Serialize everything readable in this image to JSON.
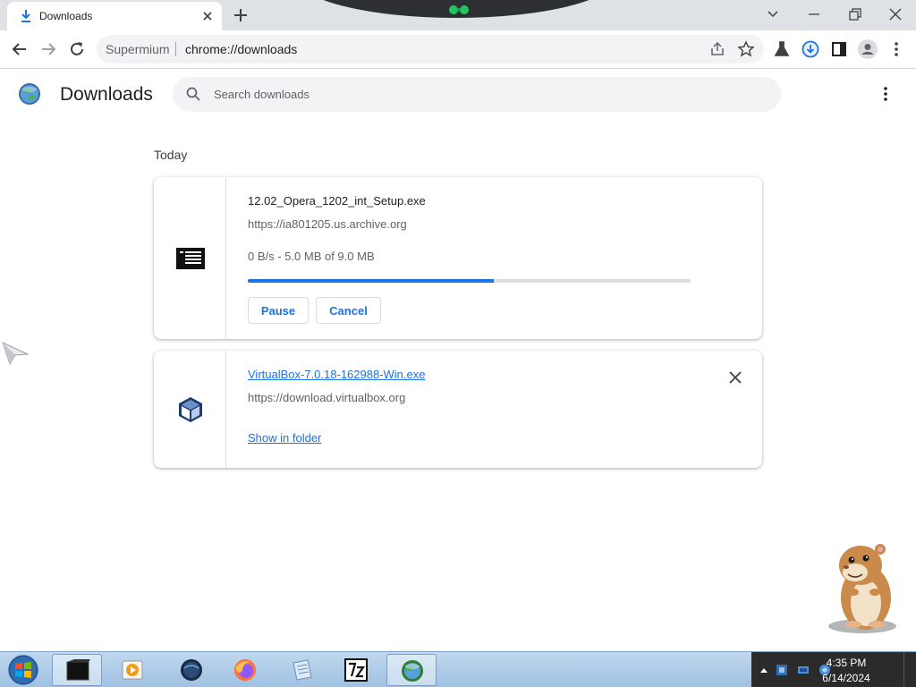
{
  "browser": {
    "tab_title": "Downloads",
    "omnibox_site": "Supermium",
    "omnibox_url": "chrome://downloads"
  },
  "page": {
    "title": "Downloads",
    "search_placeholder": "Search downloads",
    "section_label": "Today"
  },
  "downloads": [
    {
      "filename": "12.02_Opera_1202_int_Setup.exe",
      "url": "https://ia801205.us.archive.org",
      "status": "0 B/s - 5.0 MB of 9.0 MB",
      "progress": 0.555,
      "pause_label": "Pause",
      "cancel_label": "Cancel",
      "icon": "installer-file-icon"
    },
    {
      "filename": "VirtualBox-7.0.18-162988-Win.exe",
      "url": "https://download.virtualbox.org",
      "show_in_folder_label": "Show in folder",
      "icon": "virtualbox-icon"
    }
  ],
  "taskbar": {
    "time": "4:35 PM",
    "date": "6/14/2024",
    "apps": [
      "terminal-icon",
      "media-player-icon",
      "dark-globe-icon",
      "firefox-icon",
      "notepad-icon",
      "7zip-icon",
      "browser-icon"
    ]
  },
  "colors": {
    "accent": "#1a73e8",
    "tabstrip": "#dee1e6",
    "omnibox": "#f1f3f4"
  }
}
